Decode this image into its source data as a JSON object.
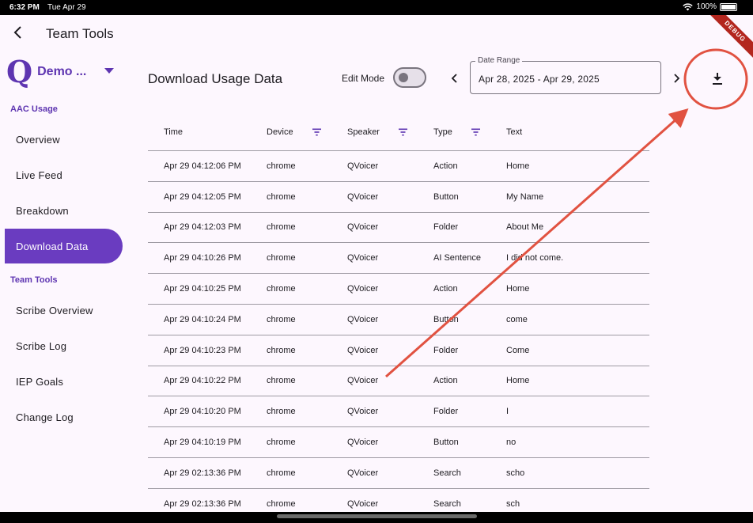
{
  "status": {
    "time": "6:32 PM",
    "date": "Tue Apr 29",
    "battery": "100%"
  },
  "app": {
    "title": "Team Tools",
    "debug_label": "DEBUG"
  },
  "brand": {
    "logo": "Q",
    "name": "Demo ..."
  },
  "sidebar": {
    "section1": "AAC Usage",
    "section2": "Team Tools",
    "items": [
      {
        "label": "Overview"
      },
      {
        "label": "Live Feed"
      },
      {
        "label": "Breakdown"
      },
      {
        "label": "Download Data"
      },
      {
        "label": "Scribe Overview"
      },
      {
        "label": "Scribe Log"
      },
      {
        "label": "IEP Goals"
      },
      {
        "label": "Change Log"
      }
    ],
    "active_index": 3
  },
  "main": {
    "title": "Download Usage Data",
    "edit_mode_label": "Edit Mode",
    "edit_mode_on": false,
    "date_range_label": "Date Range",
    "date_range_value": "Apr 28, 2025 - Apr 29, 2025"
  },
  "table": {
    "headers": [
      "Time",
      "Device",
      "Speaker",
      "Type",
      "Text"
    ],
    "rows": [
      [
        "Apr 29 04:12:06 PM",
        "chrome",
        "QVoicer",
        "Action",
        "Home"
      ],
      [
        "Apr 29 04:12:05 PM",
        "chrome",
        "QVoicer",
        "Button",
        "My Name"
      ],
      [
        "Apr 29 04:12:03 PM",
        "chrome",
        "QVoicer",
        "Folder",
        "About Me"
      ],
      [
        "Apr 29 04:10:26 PM",
        "chrome",
        "QVoicer",
        "AI Sentence",
        "I did not come."
      ],
      [
        "Apr 29 04:10:25 PM",
        "chrome",
        "QVoicer",
        "Action",
        "Home"
      ],
      [
        "Apr 29 04:10:24 PM",
        "chrome",
        "QVoicer",
        "Button",
        "come"
      ],
      [
        "Apr 29 04:10:23 PM",
        "chrome",
        "QVoicer",
        "Folder",
        "Come"
      ],
      [
        "Apr 29 04:10:22 PM",
        "chrome",
        "QVoicer",
        "Action",
        "Home"
      ],
      [
        "Apr 29 04:10:20 PM",
        "chrome",
        "QVoicer",
        "Folder",
        "I"
      ],
      [
        "Apr 29 04:10:19 PM",
        "chrome",
        "QVoicer",
        "Button",
        "no"
      ],
      [
        "Apr 29 02:13:36 PM",
        "chrome",
        "QVoicer",
        "Search",
        "scho"
      ],
      [
        "Apr 29 02:13:36 PM",
        "chrome",
        "QVoicer",
        "Search",
        "sch"
      ]
    ]
  },
  "icons": {
    "back": "arrow-back-icon",
    "dropdown": "caret-down-icon",
    "filter": "filter-icon",
    "prev": "chevron-left-icon",
    "next": "chevron-right-icon",
    "download": "download-icon"
  },
  "colors": {
    "accent": "#6a3cc0",
    "brand": "#5e35b1",
    "background": "#fdf7fe",
    "annotation": "#e15241"
  }
}
